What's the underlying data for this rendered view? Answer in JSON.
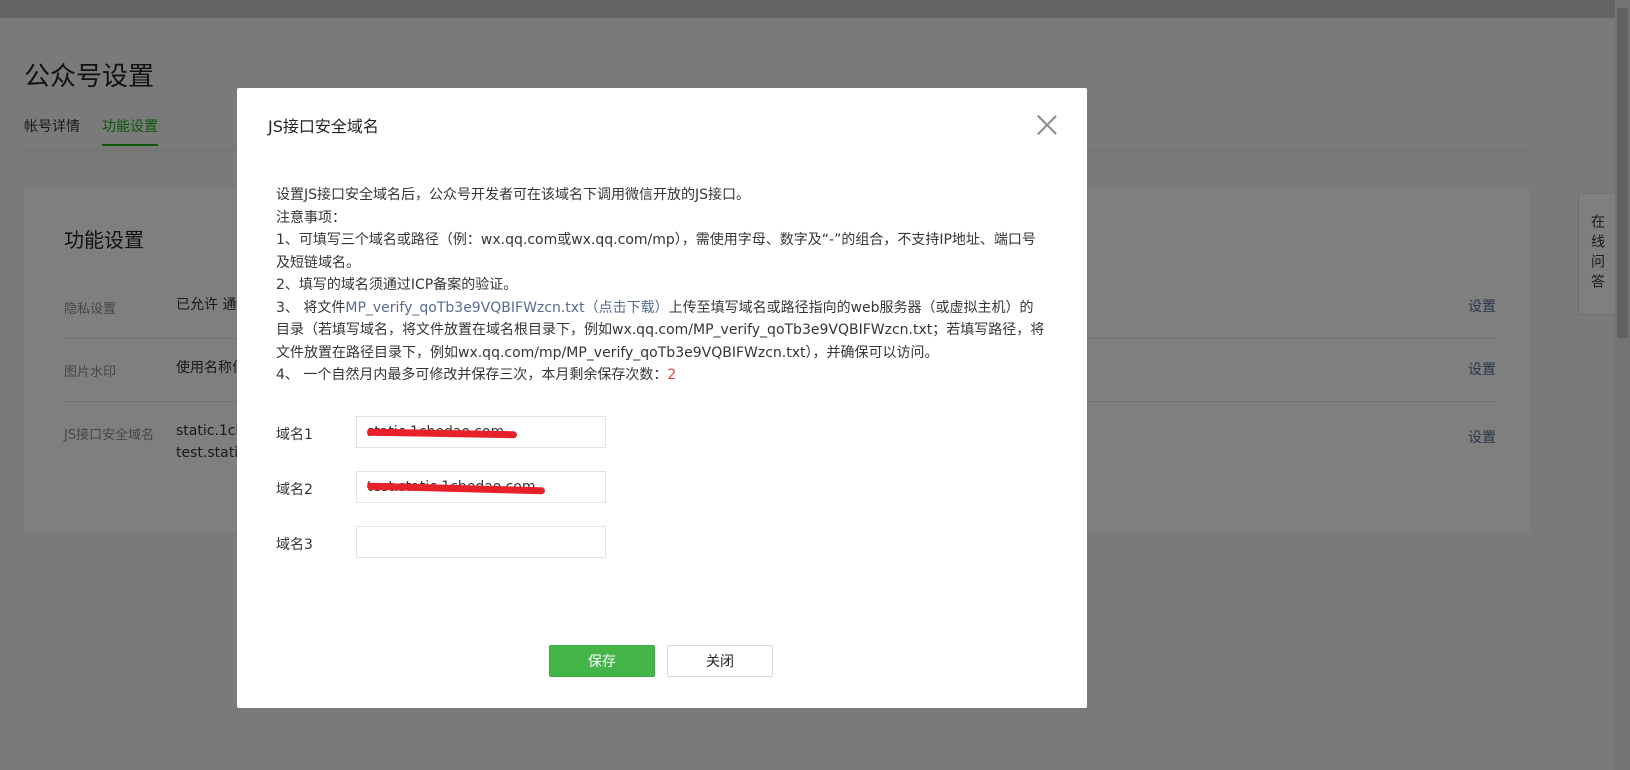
{
  "page": {
    "title": "公众号设置",
    "tabs": [
      {
        "label": "帐号详情",
        "active": false
      },
      {
        "label": "功能设置",
        "active": true
      }
    ],
    "card_title": "功能设置",
    "rows": [
      {
        "label": "隐私设置",
        "value": "已允许 通",
        "action": "设置"
      },
      {
        "label": "图片水印",
        "value": "使用名称作",
        "action": "设置"
      },
      {
        "label": "JS接口安全域名",
        "value_lines": [
          "static.1ch",
          "test.static"
        ],
        "action": "设置"
      }
    ],
    "side_help": "在线问答"
  },
  "dialog": {
    "title": "JS接口安全域名",
    "intro": "设置JS接口安全域名后，公众号开发者可在该域名下调用微信开放的JS接口。",
    "notice_heading": "注意事项：",
    "note1": "1、可填写三个域名或路径（例：wx.qq.com或wx.qq.com/mp），需使用字母、数字及“-”的组合，不支持IP地址、端口号及短链域名。",
    "note2": "2、填写的域名须通过ICP备案的验证。",
    "note3_prefix": "3、 将文件",
    "note3_file_link": "MP_verify_qoTb3e9VQBIFWzcn.txt（点击下载）",
    "note3_suffix": "上传至填写域名或路径指向的web服务器（或虚拟主机）的目录（若填写域名，将文件放置在域名根目录下，例如wx.qq.com/MP_verify_qoTb3e9VQBIFWzcn.txt；若填写路径，将文件放置在路径目录下，例如wx.qq.com/mp/MP_verify_qoTb3e9VQBIFWzcn.txt），并确保可以访问。",
    "note4_prefix": "4、 一个自然月内最多可修改并保存三次，本月剩余保存次数：",
    "note4_count": "2",
    "fields": [
      {
        "label": "域名1",
        "value": "static.1chedao.com"
      },
      {
        "label": "域名2",
        "value": "test.static.1chedao.com"
      },
      {
        "label": "域名3",
        "value": ""
      }
    ],
    "save_label": "保存",
    "close_label": "关闭"
  },
  "colors": {
    "accent_green": "#1aad19",
    "button_green": "#44b549",
    "link_blue": "#576b95",
    "highlight_red": "#e64340",
    "redaction_red": "#e8202a"
  }
}
